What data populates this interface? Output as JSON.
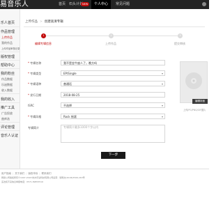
{
  "topbar": {
    "logo": "易音乐人",
    "nav": [
      {
        "label": "首页"
      },
      {
        "label": "石头计划"
      },
      {
        "label": "个人中心"
      },
      {
        "label": "常见问题"
      }
    ],
    "badge": "NEW"
  },
  "sidebar": {
    "sections": [
      {
        "label": "乐人首页"
      },
      {
        "label": "作品管理",
        "subs": [
          "上传作品",
          "我的作品",
          "上传作品审核记录"
        ]
      },
      {
        "label": "版权管理"
      },
      {
        "label": "帮助中心"
      },
      {
        "label": "我的粉丝",
        "subs": [
          "作品数据",
          "乐迷数据",
          "收入数据"
        ]
      },
      {
        "label": "我的收入"
      },
      {
        "label": "推广工具",
        "subs": [
          "广告投放",
          "曲库选"
        ]
      },
      {
        "label": "评论管理"
      },
      {
        "label": "音乐人认证"
      }
    ]
  },
  "breadcrumb": {
    "root": "上传作品",
    "current": "创建高清专辑"
  },
  "steps": [
    {
      "num": "1",
      "label": "编辑专辑信息"
    },
    {
      "num": "2",
      "label": "上传作品"
    },
    {
      "num": "3",
      "label": "提交审核"
    }
  ],
  "form": {
    "album_name": {
      "label": "专辑名称",
      "value": "我不是金牛座人了，晚方吗"
    },
    "album_type": {
      "label": "专辑类型",
      "value": "EP/Single"
    },
    "album_lang": {
      "label": "专辑语种",
      "value": "普通话"
    },
    "release_date": {
      "label": "发行日期",
      "value": "2018-08-25"
    },
    "isrc": {
      "label": "ISRC",
      "value": "不选择"
    },
    "genre": {
      "label": "专辑风格",
      "value": "Rock 摇滚"
    },
    "intro": {
      "label": "专辑简介",
      "placeholder": "专辑简介最多1000个字以内"
    }
  },
  "cover": {
    "button": "编辑封面",
    "tip": "上传JPG/PNG/GIF图片"
  },
  "next_button": "下一步",
  "footer": {
    "links": [
      "用户指南",
      "关于我们",
      "版权申诉",
      "联系我们"
    ],
    "line2": "网易公司版权所有©1997-2018 杭州乐读科技有限公司运营：浙网文[2018]3506-263号",
    "line3": "违法和不良信息举报电话：0571-89853516"
  },
  "colors": {
    "accent": "#c20c0c",
    "topbar": "#242424"
  }
}
